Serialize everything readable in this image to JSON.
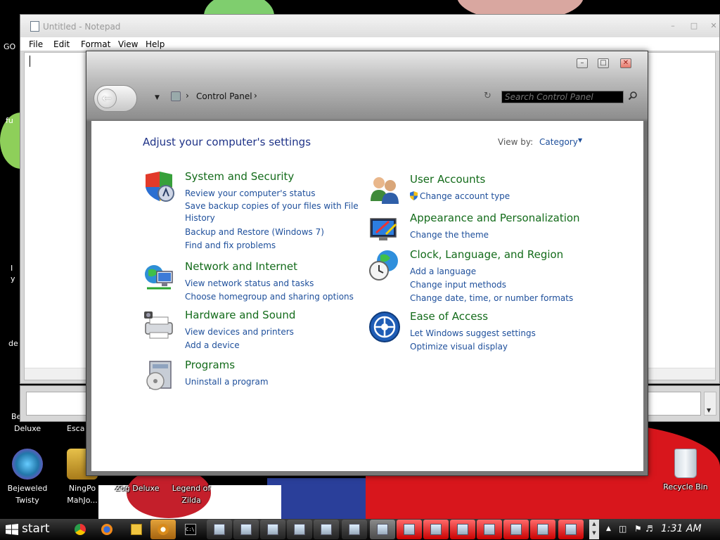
{
  "desktop": {
    "icons": [
      {
        "label": "Bejeweled Twisty"
      },
      {
        "label": "NingPo MahJo..."
      },
      {
        "label": "Zog Deluxe"
      },
      {
        "label": "Legend of Zilda"
      },
      {
        "label": "Recycle Bin"
      }
    ],
    "fragments": [
      "GO",
      "fu",
      "I",
      "y",
      "de",
      "Be",
      "Deluxe",
      "Esca"
    ]
  },
  "notepad": {
    "title": "Untitled - Notepad",
    "menu": [
      "File",
      "Edit",
      "Format",
      "View",
      "Help"
    ]
  },
  "control_panel": {
    "breadcrumb": "Control Panel",
    "search_placeholder": "Search Control Panel",
    "heading": "Adjust your computer's settings",
    "view_by_label": "View by:",
    "view_by_value": "Category",
    "categories": [
      {
        "title": "System and Security",
        "icon": "shield-icon",
        "links": [
          "Review your computer's status",
          "Save backup copies of your files with File History",
          "Backup and Restore (Windows 7)",
          "Find and fix problems"
        ]
      },
      {
        "title": "Network and Internet",
        "icon": "network-icon",
        "links": [
          "View network status and tasks",
          "Choose homegroup and sharing options"
        ]
      },
      {
        "title": "Hardware and Sound",
        "icon": "printer-icon",
        "links": [
          "View devices and printers",
          "Add a device"
        ]
      },
      {
        "title": "Programs",
        "icon": "programs-icon",
        "links": [
          "Uninstall a program"
        ]
      },
      {
        "title": "User Accounts",
        "icon": "users-icon",
        "links": [
          "Change account type"
        ]
      },
      {
        "title": "Appearance and Personalization",
        "icon": "display-icon",
        "links": [
          "Change the theme"
        ]
      },
      {
        "title": "Clock, Language, and Region",
        "icon": "globe-clock-icon",
        "links": [
          "Add a language",
          "Change input methods",
          "Change date, time, or number formats"
        ]
      },
      {
        "title": "Ease of Access",
        "icon": "ease-of-access-icon",
        "links": [
          "Let Windows suggest settings",
          "Optimize visual display"
        ]
      }
    ]
  },
  "taskbar": {
    "start_label": "start",
    "clock": "1:31 AM"
  },
  "colors": {
    "category_title": "#136b1a",
    "link": "#1e4f9b",
    "heading": "#1e3287"
  }
}
